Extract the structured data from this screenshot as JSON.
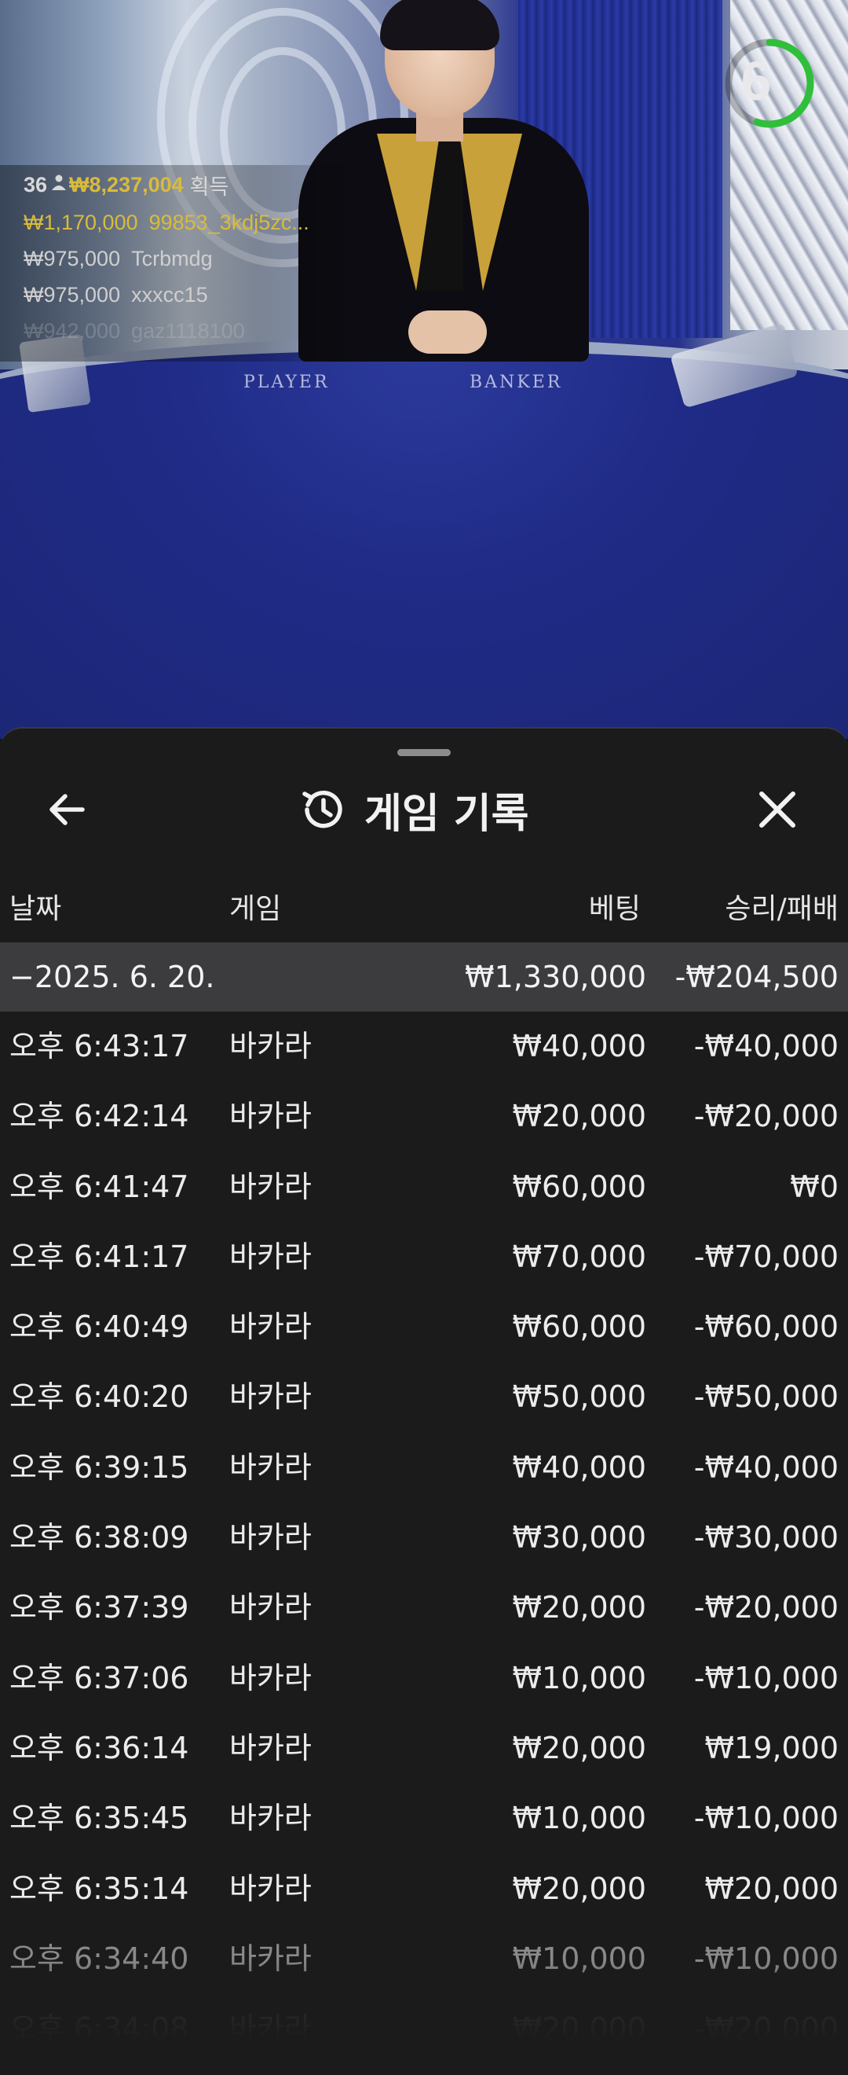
{
  "stream": {
    "timer": "6",
    "timer_progress": 0.55,
    "table_labels": {
      "player": "PLAYER",
      "banker": "BANKER"
    }
  },
  "ticker": {
    "count": "36",
    "total": "₩8,237,004",
    "earned_label": "획득",
    "rows": [
      {
        "amount": "₩1,170,000",
        "name": "99853_3kdj5zc..."
      },
      {
        "amount": "₩975,000",
        "name": "Tcrbmdg"
      },
      {
        "amount": "₩975,000",
        "name": "xxxcc15"
      },
      {
        "amount": "₩942,000",
        "name": "gaz1118100"
      }
    ]
  },
  "sheet": {
    "title": "게임 기록",
    "columns": {
      "date": "날짜",
      "game": "게임",
      "bet": "베팅",
      "result": "승리/패배"
    },
    "date_group": {
      "date": "−2025. 6. 20.",
      "bet": "₩1,330,000",
      "result": "-₩204,500"
    },
    "rows": [
      {
        "time": "오후 6:43:17",
        "game": "바카라",
        "bet": "₩40,000",
        "result": "-₩40,000"
      },
      {
        "time": "오후 6:42:14",
        "game": "바카라",
        "bet": "₩20,000",
        "result": "-₩20,000"
      },
      {
        "time": "오후 6:41:47",
        "game": "바카라",
        "bet": "₩60,000",
        "result": "₩0"
      },
      {
        "time": "오후 6:41:17",
        "game": "바카라",
        "bet": "₩70,000",
        "result": "-₩70,000"
      },
      {
        "time": "오후 6:40:49",
        "game": "바카라",
        "bet": "₩60,000",
        "result": "-₩60,000"
      },
      {
        "time": "오후 6:40:20",
        "game": "바카라",
        "bet": "₩50,000",
        "result": "-₩50,000"
      },
      {
        "time": "오후 6:39:15",
        "game": "바카라",
        "bet": "₩40,000",
        "result": "-₩40,000"
      },
      {
        "time": "오후 6:38:09",
        "game": "바카라",
        "bet": "₩30,000",
        "result": "-₩30,000"
      },
      {
        "time": "오후 6:37:39",
        "game": "바카라",
        "bet": "₩20,000",
        "result": "-₩20,000"
      },
      {
        "time": "오후 6:37:06",
        "game": "바카라",
        "bet": "₩10,000",
        "result": "-₩10,000"
      },
      {
        "time": "오후 6:36:14",
        "game": "바카라",
        "bet": "₩20,000",
        "result": "₩19,000"
      },
      {
        "time": "오후 6:35:45",
        "game": "바카라",
        "bet": "₩10,000",
        "result": "-₩10,000"
      },
      {
        "time": "오후 6:35:14",
        "game": "바카라",
        "bet": "₩20,000",
        "result": "₩20,000"
      },
      {
        "time": "오후 6:34:40",
        "game": "바카라",
        "bet": "₩10,000",
        "result": "-₩10,000"
      },
      {
        "time": "오후 6:34:08",
        "game": "바카라",
        "bet": "₩20,000",
        "result": "-₩20,000"
      }
    ]
  },
  "icons": {
    "back": "arrow-left-icon",
    "close": "close-icon",
    "title": "history-icon",
    "player": "person-icon"
  },
  "colors": {
    "sheet_bg": "#1b1b1c",
    "date_row_bg": "#3c3c3e",
    "gold": "#d9bb3c",
    "timer_green": "#2fbf3a"
  }
}
